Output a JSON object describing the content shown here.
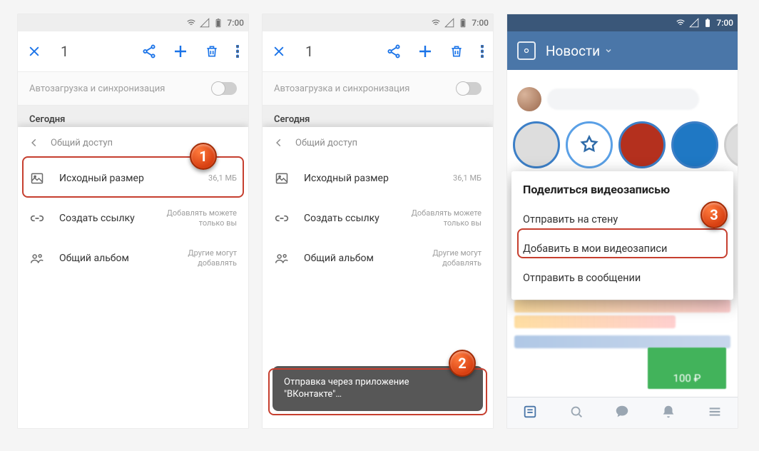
{
  "statusbar": {
    "time": "7:00"
  },
  "toolbar": {
    "count": "1"
  },
  "autoload": {
    "label": "Автозагрузка и синхронизация"
  },
  "section": {
    "today": "Сегодня"
  },
  "sheet": {
    "header": "Общий доступ",
    "originalSize": {
      "label": "Исходный размер",
      "sub": "36,1 МБ"
    },
    "createLink": {
      "label": "Создать ссылку",
      "sub1": "Добавлять можете",
      "sub2": "только вы"
    },
    "sharedAlbum": {
      "label": "Общий альбом",
      "sub1": "Другие могут",
      "sub2": "добавлять"
    }
  },
  "toast": {
    "line1": "Отправка через приложение",
    "line2": "\"ВКонтакте\"…"
  },
  "vk": {
    "title": "Новости",
    "shareTitle": "Поделиться видеозаписью",
    "optWall": "Отправить на стену",
    "optAdd": "Добавить в мои видеозаписи",
    "optMsg": "Отправить в сообщении",
    "price": "100 ₽"
  }
}
